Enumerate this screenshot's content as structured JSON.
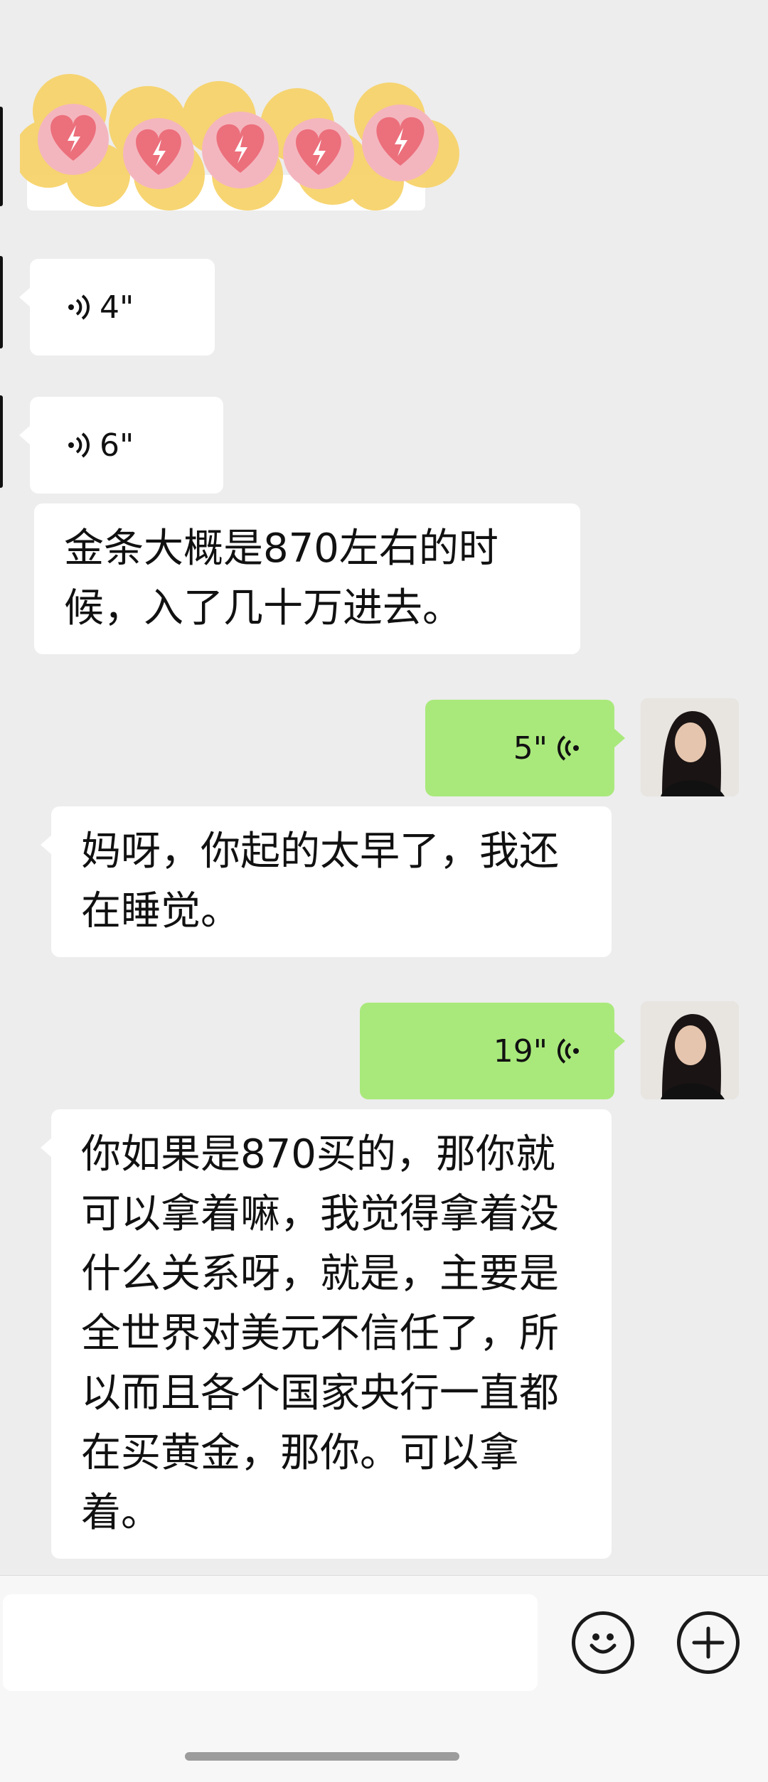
{
  "messages": [
    {
      "id": "sticker",
      "type": "sticker",
      "side": "left",
      "description": "hearts-sticker"
    },
    {
      "id": "voice1",
      "type": "voice",
      "side": "left",
      "duration": "4\""
    },
    {
      "id": "voice2",
      "type": "voice",
      "side": "left",
      "duration": "6\""
    },
    {
      "id": "text1",
      "type": "text",
      "side": "left",
      "text": "金条大概是870左右的时候，入了几十万进去。"
    },
    {
      "id": "voice3",
      "type": "voice",
      "side": "right",
      "duration": "5\""
    },
    {
      "id": "text2",
      "type": "text",
      "side": "left",
      "text": "妈呀，你起的太早了，我还在睡觉。"
    },
    {
      "id": "voice4",
      "type": "voice",
      "side": "right",
      "duration": "19\""
    },
    {
      "id": "text3",
      "type": "text",
      "side": "left",
      "text": "你如果是870买的，那你就可以拿着嘛，我觉得拿着没什么关系呀，就是，主要是全世界对美元不信任了，所以而且各个国家央行一直都在买黄金，那你。可以拿着。"
    }
  ],
  "input": {
    "value": "",
    "placeholder": ""
  },
  "icons": {
    "emoji": "emoji-icon",
    "plus": "plus-icon",
    "voice": "voice-wave-icon"
  },
  "colors": {
    "background": "#ededed",
    "sent_bubble": "#a9e97b",
    "received_bubble": "#ffffff"
  }
}
